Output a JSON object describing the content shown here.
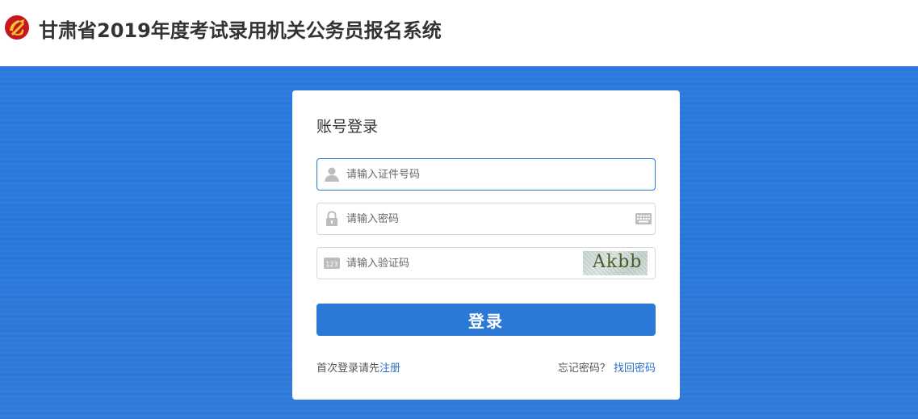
{
  "header": {
    "title": "甘肃省2019年度考试录用机关公务员报名系统",
    "emblem_icon": "party-emblem-icon"
  },
  "login": {
    "title": "账号登录",
    "username_placeholder": "请输入证件号码",
    "password_placeholder": "请输入密码",
    "captcha_placeholder": "请输入验证码",
    "captcha_text": "Akbb",
    "submit_label": "登录",
    "register_prefix": "首次登录请先",
    "register_link": "注册",
    "forgot_prefix": "忘记密码？",
    "forgot_link": "找回密码"
  },
  "colors": {
    "banner": "#2b79dd",
    "button": "#2b78d6",
    "link": "#2b6fc4",
    "emblem": "#c8161d"
  }
}
